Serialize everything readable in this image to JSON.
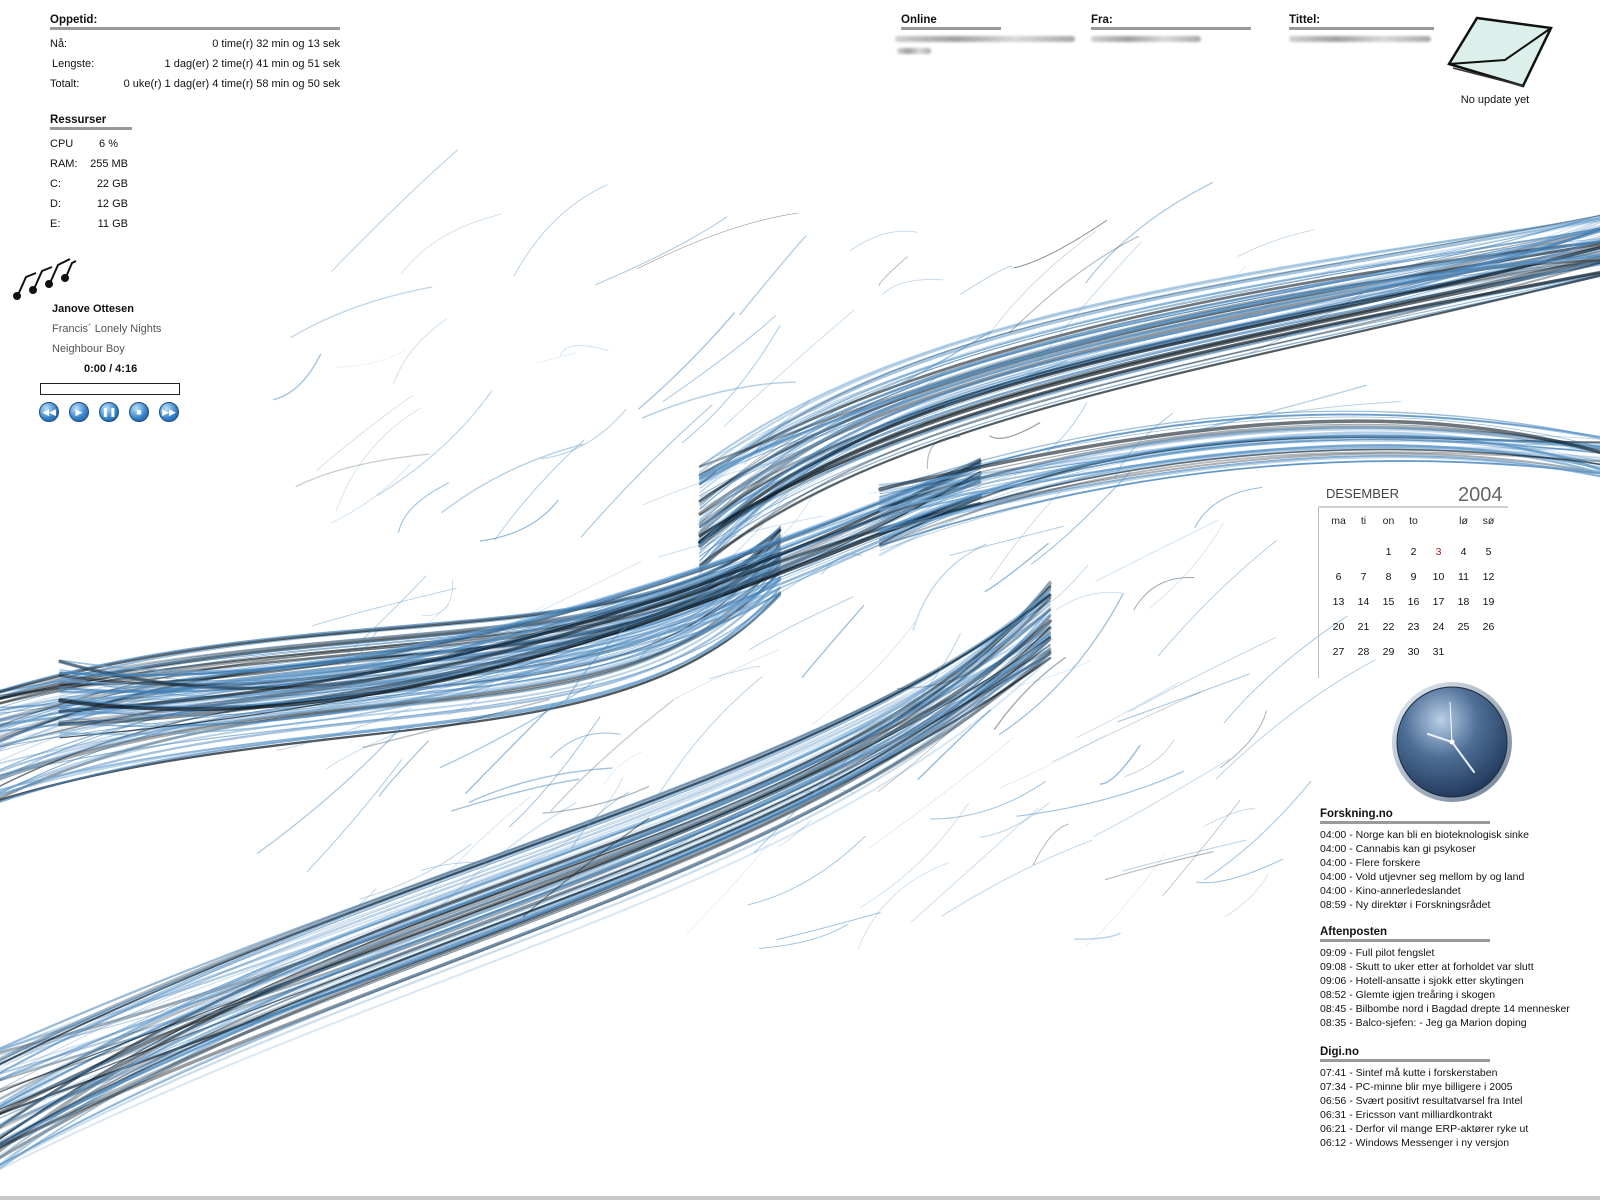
{
  "colors": {
    "accent": "#3f7fb8",
    "dark": "#0c1a24",
    "header_rule": "#9a9a9a",
    "today": "#b02020"
  },
  "uptime": {
    "title": "Oppetid:",
    "rows": [
      {
        "label": "Nå:",
        "value": "0 time(r) 32 min og 13 sek"
      },
      {
        "label": "Lengste:",
        "value": "1 dag(er) 2 time(r) 41 min og 51 sek"
      },
      {
        "label": "Totalt:",
        "value": "0 uke(r) 1 dag(er) 4 time(r) 58 min og 50 sek"
      }
    ]
  },
  "resources": {
    "title": "Ressurser",
    "rows": [
      {
        "label": "CPU",
        "value": "6 %"
      },
      {
        "label": "RAM:",
        "value": "255 MB"
      },
      {
        "label": "C:",
        "value": "22 GB"
      },
      {
        "label": "D:",
        "value": "12 GB"
      },
      {
        "label": "E:",
        "value": "11 GB"
      }
    ]
  },
  "music": {
    "icon": "music-notes-icon",
    "artist": "Janove Ottesen",
    "tracks": [
      "Francis´ Lonely Nights",
      "Neighbour Boy"
    ],
    "time": "0:00 / 4:16",
    "progress": 0,
    "controls": [
      {
        "name": "previous-button",
        "icon": "previous-icon",
        "glyph": "◀◀"
      },
      {
        "name": "play-button",
        "icon": "play-icon",
        "glyph": "▶"
      },
      {
        "name": "pause-button",
        "icon": "pause-icon",
        "glyph": "❚❚"
      },
      {
        "name": "stop-button",
        "icon": "stop-icon",
        "glyph": "■"
      },
      {
        "name": "next-button",
        "icon": "next-icon",
        "glyph": "▶▶"
      }
    ]
  },
  "mail": {
    "columns": [
      "Online",
      "Fra:",
      "Tittel:"
    ],
    "envelope_icon": "envelope-icon",
    "status": "No update yet"
  },
  "calendar": {
    "month": "DESEMBER",
    "year": "2004",
    "weekdays": [
      "ma",
      "ti",
      "on",
      "to",
      "",
      "lø",
      "sø"
    ],
    "today": "3",
    "weeks": [
      [
        "",
        "",
        "1",
        "2",
        "3",
        "4",
        "5"
      ],
      [
        "6",
        "7",
        "8",
        "9",
        "10",
        "11",
        "12"
      ],
      [
        "13",
        "14",
        "15",
        "16",
        "17",
        "18",
        "19"
      ],
      [
        "20",
        "21",
        "22",
        "23",
        "24",
        "25",
        "26"
      ],
      [
        "27",
        "28",
        "29",
        "30",
        "31",
        "",
        ""
      ]
    ]
  },
  "clock": {
    "icon": "analog-clock-icon"
  },
  "news": [
    {
      "id": "news-forskning",
      "title": "Forskning.no",
      "items": [
        "04:00 - Norge kan bli en bioteknologisk sinke",
        "04:00 - Cannabis kan gi psykoser",
        "04:00 - Flere forskere",
        "04:00 - Vold utjevner seg mellom by og land",
        "04:00 - Kino-annerledeslandet",
        "08:59 - Ny direktør i Forskningsrådet"
      ]
    },
    {
      "id": "news-aftenposten",
      "title": "Aftenposten",
      "items": [
        "09:09 - Full pilot fengslet",
        "09:08 - Skutt to uker etter at forholdet var slutt",
        "09:06 - Hotell-ansatte i sjokk etter skytingen",
        "08:52 - Glemte igjen treåring i skogen",
        "08:45 - Bilbombe nord i Bagdad drepte 14 mennesker",
        "08:35 - Balco-sjefen: - Jeg ga Marion doping"
      ]
    },
    {
      "id": "news-digi",
      "title": "Digi.no",
      "items": [
        "07:41 - Sintef må kutte i forskerstaben",
        "07:34 - PC-minne blir mye billigere i 2005",
        "06:56 - Svært positivt resultatvarsel fra Intel",
        "06:31 - Ericsson vant milliardkontrakt",
        "06:21 - Derfor vil mange ERP-aktører ryke ut",
        "06:12 - Windows Messenger i ny versjon"
      ]
    }
  ]
}
